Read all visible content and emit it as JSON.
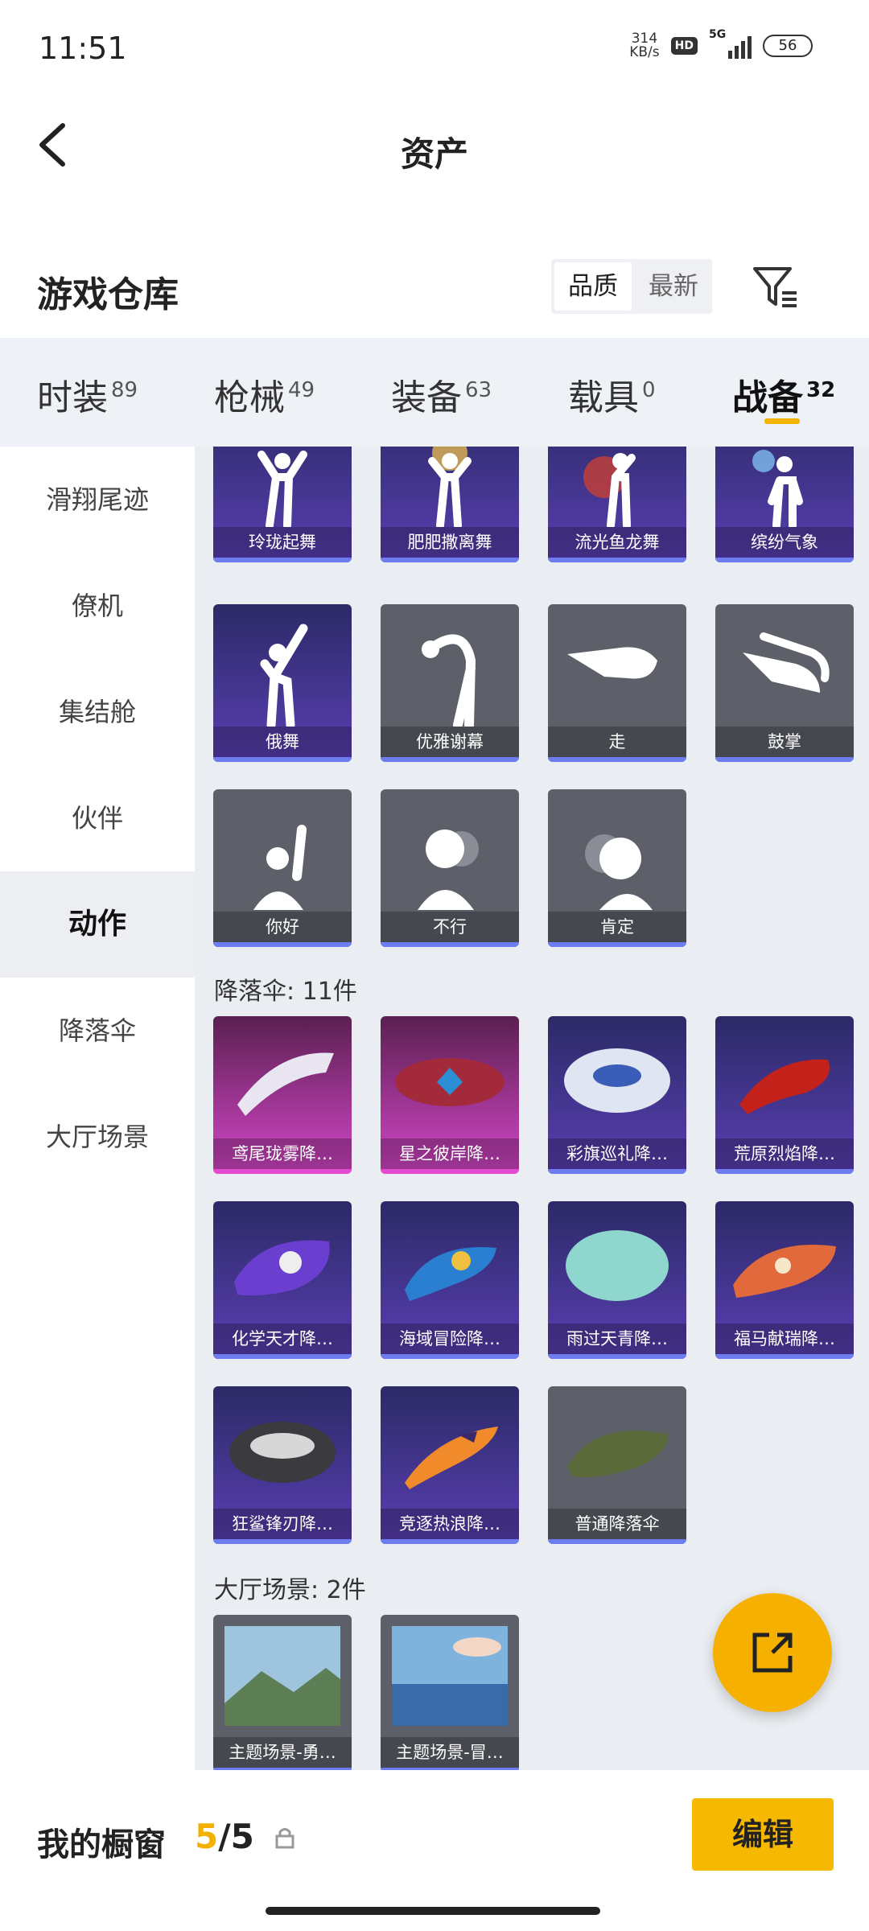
{
  "status": {
    "time": "11:51",
    "net_speed_value": "314",
    "net_speed_unit": "KB/s",
    "hd": "HD",
    "network": "5G",
    "battery": "56"
  },
  "header": {
    "title": "资产"
  },
  "warehouse": {
    "title": "游戏仓库",
    "sort_quality": "品质",
    "sort_newest": "最新"
  },
  "tabs": [
    {
      "label": "时装",
      "count": "89"
    },
    {
      "label": "枪械",
      "count": "49"
    },
    {
      "label": "装备",
      "count": "63"
    },
    {
      "label": "载具",
      "count": "0"
    },
    {
      "label": "战备",
      "count": "32"
    }
  ],
  "sidebar": {
    "items": [
      "滑翔尾迹",
      "僚机",
      "集结舱",
      "伙伴",
      "动作",
      "降落伞",
      "大厅场景"
    ]
  },
  "emotes": [
    "玲珑起舞",
    "肥肥撒离舞",
    "流光鱼龙舞",
    "缤纷气象",
    "俄舞",
    "优雅谢幕",
    "走",
    "鼓掌",
    "你好",
    "不行",
    "肯定"
  ],
  "parachute_section": {
    "title": "降落伞: 11件"
  },
  "parachutes": [
    "鸢尾珑雾降…",
    "星之彼岸降…",
    "彩旗巡礼降…",
    "荒原烈焰降…",
    "化学天才降…",
    "海域冒险降…",
    "雨过天青降…",
    "福马献瑞降…",
    "狂鲨锋刃降…",
    "竞逐热浪降…",
    "普通降落伞"
  ],
  "lobby_section": {
    "title": "大厅场景: 2件"
  },
  "lobby_scenes": [
    "主题场景-勇…",
    "主题场景-冒…"
  ],
  "bottom": {
    "window_label": "我的橱窗",
    "window_current": "5",
    "window_total": "/5",
    "edit": "编辑"
  },
  "colors": {
    "accent": "#f6b800",
    "purple_card": "#4a3aa0",
    "gray_card": "#5d6069",
    "pink_card": "#d546c9"
  }
}
